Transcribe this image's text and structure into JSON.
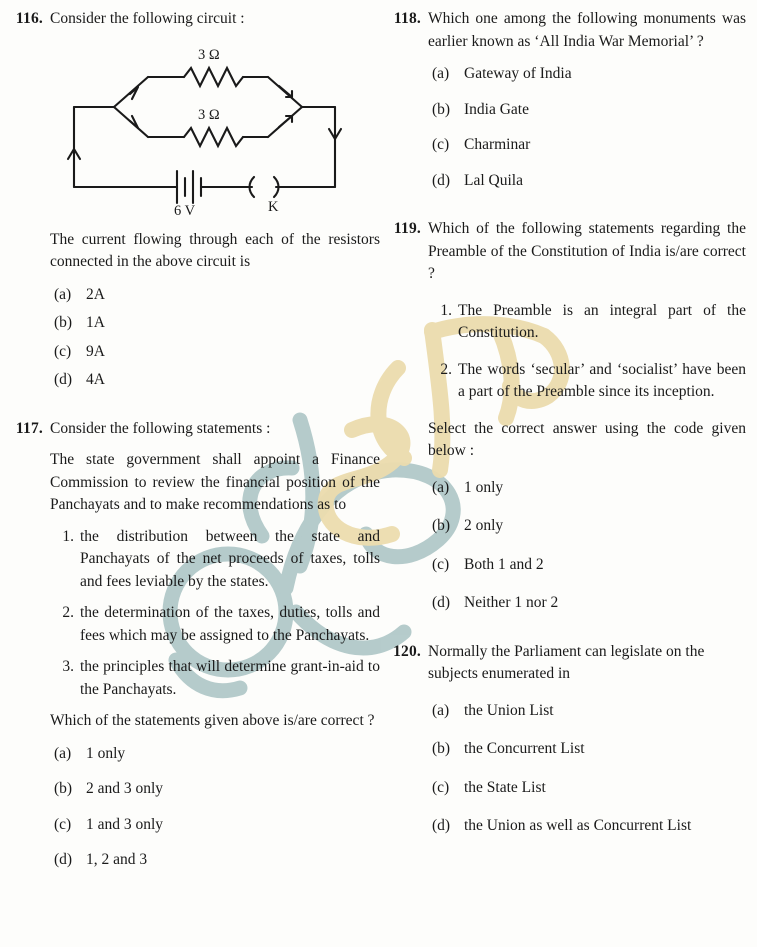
{
  "page": {
    "background": "#fdfdfb",
    "ink": "#1a1a1a",
    "watermark": {
      "teal": "#b2c9c9",
      "tan": "#ecdcae",
      "script_text": "ओडिशा"
    }
  },
  "questions": [
    {
      "number": "116.",
      "stem": "Consider the following circuit :",
      "figure": {
        "kind": "circuit-diagram",
        "resistor_top_label": "3 Ω",
        "resistor_bottom_label": "3 Ω",
        "battery_label": "6 V",
        "switch_label": "K",
        "topology": "two 3 ohm resistors in parallel with a 6 V battery and switch K"
      },
      "para": "The current flowing through each of the resistors connected in the above circuit is",
      "statements": [],
      "options": [
        {
          "key": "(a)",
          "text": "2A"
        },
        {
          "key": "(b)",
          "text": "1A"
        },
        {
          "key": "(c)",
          "text": "9A"
        },
        {
          "key": "(d)",
          "text": "4A"
        }
      ]
    },
    {
      "number": "117.",
      "stem": "Consider the following statements :",
      "para": "The state government shall appoint a Finance Commission to review the financial position of the Panchayats and to make recommendations as to",
      "statements": [
        {
          "num": "1.",
          "text": "the distribution between the state and Panchayats of the net proceeds of taxes, tolls and fees leviable by the states."
        },
        {
          "num": "2.",
          "text": "the determination of the taxes, duties, tolls and fees which may be assigned to the Panchayats."
        },
        {
          "num": "3.",
          "text": "the principles that will determine grant-in-aid to the Panchayats."
        }
      ],
      "closing": "Which of the statements given above is/are correct ?",
      "options": [
        {
          "key": "(a)",
          "text": "1 only"
        },
        {
          "key": "(b)",
          "text": "2 and 3 only"
        },
        {
          "key": "(c)",
          "text": "1 and 3 only"
        },
        {
          "key": "(d)",
          "text": "1, 2 and 3"
        }
      ]
    },
    {
      "number": "118.",
      "stem": "Which one among the following monuments was earlier known as ‘All India War Memorial’ ?",
      "options": [
        {
          "key": "(a)",
          "text": "Gateway of India"
        },
        {
          "key": "(b)",
          "text": "India Gate"
        },
        {
          "key": "(c)",
          "text": "Charminar"
        },
        {
          "key": "(d)",
          "text": "Lal Quila"
        }
      ]
    },
    {
      "number": "119.",
      "stem": "Which of the following statements regarding the Preamble of the Constitution of India is/are correct ?",
      "statements": [
        {
          "num": "1.",
          "text": "The Preamble is an integral part of the Constitution."
        },
        {
          "num": "2.",
          "text": "The words ‘secular’ and ‘socialist’ have been a part of the Preamble since its inception."
        }
      ],
      "closing": "Select the correct answer using the code given below :",
      "options": [
        {
          "key": "(a)",
          "text": "1 only"
        },
        {
          "key": "(b)",
          "text": "2 only"
        },
        {
          "key": "(c)",
          "text": "Both 1 and 2"
        },
        {
          "key": "(d)",
          "text": "Neither 1 nor 2"
        }
      ]
    },
    {
      "number": "120.",
      "stem": "Normally the Parliament can legislate on the subjects enumerated in",
      "options": [
        {
          "key": "(a)",
          "text": "the Union List"
        },
        {
          "key": "(b)",
          "text": "the Concurrent List"
        },
        {
          "key": "(c)",
          "text": "the State List"
        },
        {
          "key": "(d)",
          "text": "the Union as well as Concurrent List"
        }
      ]
    }
  ]
}
